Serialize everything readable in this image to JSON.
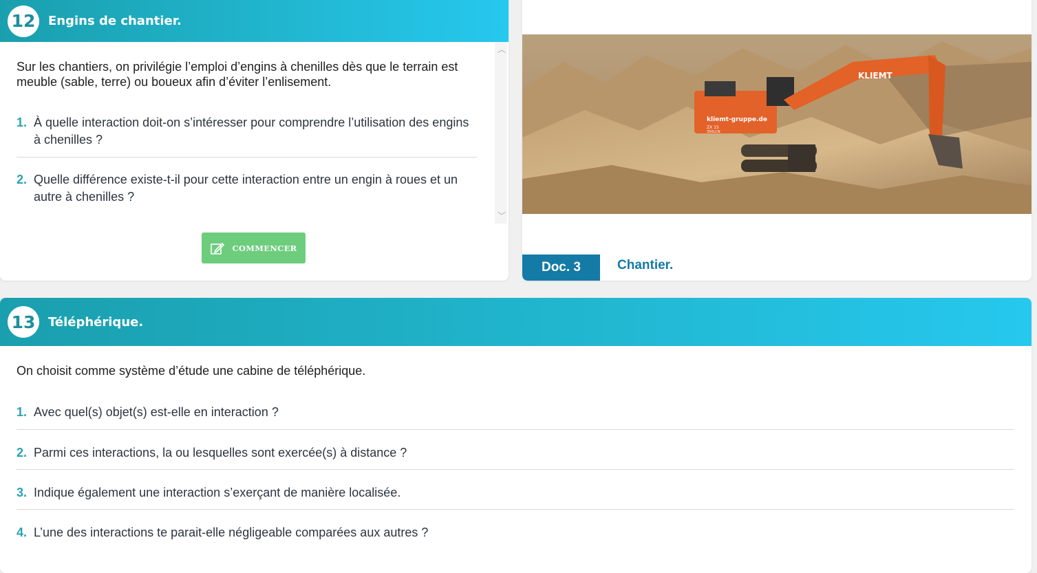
{
  "activity12": {
    "number": "12",
    "title": "Engins de chantier.",
    "intro": "Sur les chantiers, on privilégie l’emploi d’engins à chenilles dès que le terrain est meuble (sable, terre) ou boueux afin d’éviter l’enlisement.",
    "questions": [
      {
        "n": "1.",
        "text": "À quelle interaction doit-on s’intéresser pour comprendre l’utilisation des engins à chenilles ?"
      },
      {
        "n": "2.",
        "text": "Quelle différence existe-t-il pour cette interaction entre un engin à roues et un autre à chenilles ?"
      }
    ],
    "button_label": "COMMENCER",
    "button_icon": "edit-icon"
  },
  "document": {
    "tag": "Doc. 3",
    "title": "Chantier.",
    "image": {
      "description_icon": "excavator-photo",
      "brand_text": "KLIEMT",
      "site_text": "kliemt-gruppe.de",
      "model_text": "ZX 15",
      "model_sub": "350LCN"
    }
  },
  "activity13": {
    "number": "13",
    "title": "Téléphérique.",
    "intro": "On choisit comme système d’étude une cabine de téléphérique.",
    "questions": [
      {
        "n": "1.",
        "text": "Avec quel(s) objet(s) est-elle en interaction ?"
      },
      {
        "n": "2.",
        "text": "Parmi ces interactions, la ou lesquelles sont exercée(s) à distance ?"
      },
      {
        "n": "3.",
        "text": "Indique également une interaction s’exerçant de manière localisée."
      },
      {
        "n": "4.",
        "text": "L’une des interactions te parait-elle négligeable comparées aux autres ?"
      }
    ]
  },
  "colors": {
    "header_start": "#1a9fae",
    "header_end": "#26c8ee",
    "question_number": "#2aa1b3",
    "button": "#6dcd7d",
    "doc_accent": "#147aa6"
  }
}
